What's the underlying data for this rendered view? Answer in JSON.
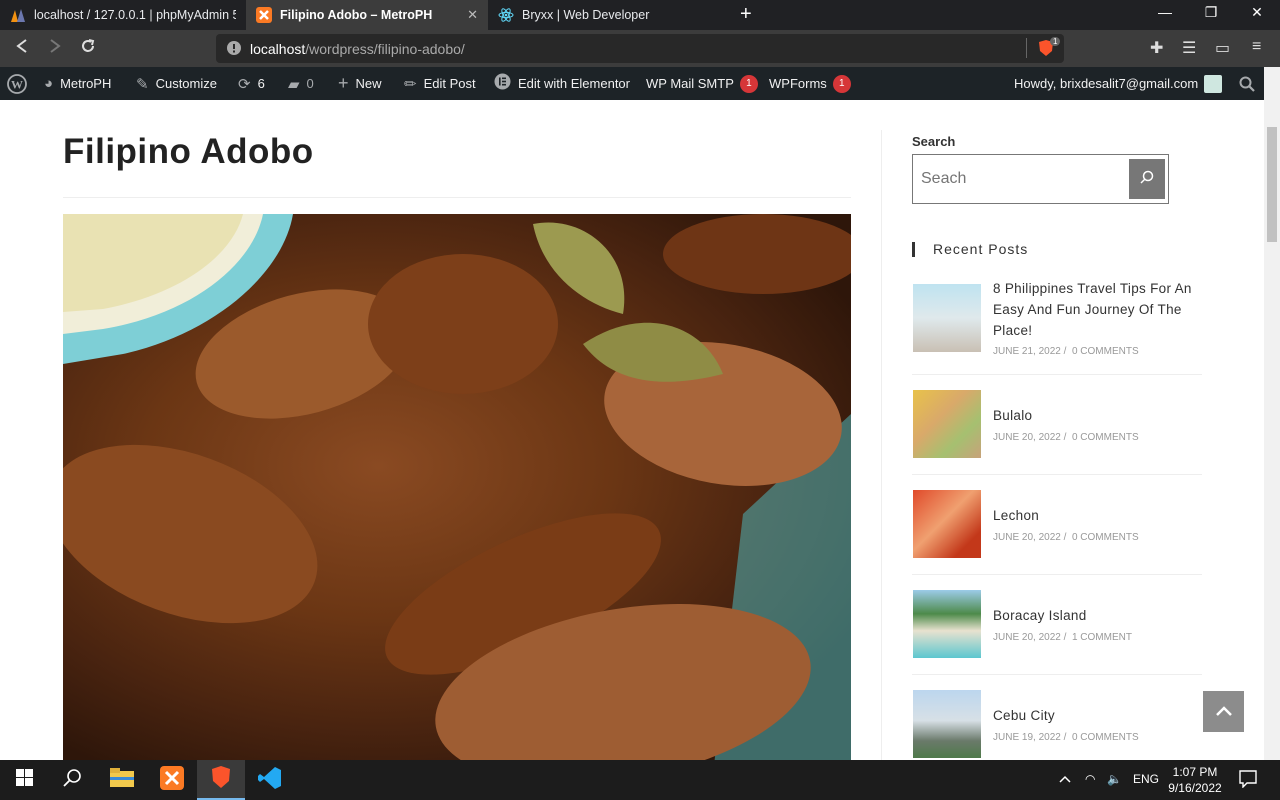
{
  "browser": {
    "tabs": [
      {
        "title": "localhost / 127.0.0.1 | phpMyAdmin 5.",
        "active": false
      },
      {
        "title": "Filipino Adobo – MetroPH",
        "active": true
      },
      {
        "title": "Bryxx | Web Developer",
        "active": false
      }
    ],
    "url_host": "localhost",
    "url_path": "/wordpress/filipino-adobo/",
    "shield_count": "1"
  },
  "adminbar": {
    "site": "MetroPH",
    "customize": "Customize",
    "updates": "6",
    "comments": "0",
    "new": "New",
    "edit_post": "Edit Post",
    "elementor": "Edit with Elementor",
    "smtp": "WP Mail SMTP",
    "smtp_badge": "1",
    "wpforms": "WPForms",
    "wpforms_badge": "1",
    "howdy": "Howdy, brixdesalit7@gmail.com"
  },
  "post": {
    "title": "Filipino Adobo"
  },
  "sidebar": {
    "search_label": "Search",
    "search_placeholder": "Seach",
    "recent_heading": "Recent Posts",
    "recent_posts": [
      {
        "title": "8 Philippines Travel Tips For An Easy And Fun Journey Of The Place!",
        "date": "JUNE 21, 2022",
        "comments": "0 COMMENTS"
      },
      {
        "title": "Bulalo",
        "date": "JUNE 20, 2022",
        "comments": "0 COMMENTS"
      },
      {
        "title": "Lechon",
        "date": "JUNE 20, 2022",
        "comments": "0 COMMENTS"
      },
      {
        "title": "Boracay Island",
        "date": "JUNE 20, 2022",
        "comments": "1 COMMENT"
      },
      {
        "title": "Cebu City",
        "date": "JUNE 19, 2022",
        "comments": "0 COMMENTS"
      }
    ]
  },
  "taskbar": {
    "lang": "ENG",
    "time": "1:07 PM",
    "date": "9/16/2022"
  }
}
